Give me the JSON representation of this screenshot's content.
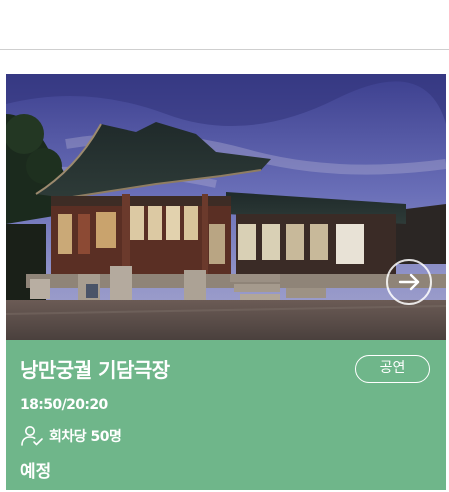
{
  "card": {
    "image_alt": "Nakseonjae hanok building at dusk",
    "title": "낭만궁궐 기담극장",
    "category": "공연",
    "times": "18:50/20:20",
    "capacity": "회차당 50명",
    "status": "예정",
    "next_icon": "arrow-right-circle-icon",
    "user_icon": "person-check-icon"
  },
  "colors": {
    "card_background": "#6fb68a",
    "text": "#ffffff",
    "divider": "#cfcfcf"
  }
}
